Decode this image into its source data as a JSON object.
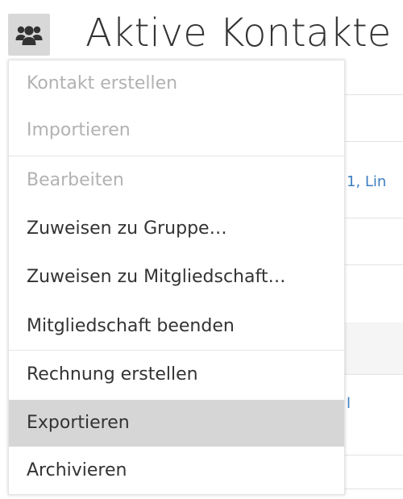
{
  "header": {
    "icon": "users-icon",
    "title": "Aktive Kontakte"
  },
  "background_table": {
    "row_link_1": "1, Lin",
    "row_link_2": "l"
  },
  "menu": {
    "items": [
      {
        "label": "Kontakt erstellen",
        "state": "disabled"
      },
      {
        "label": "Importieren",
        "state": "disabled"
      },
      {
        "label": "Bearbeiten",
        "state": "disabled"
      },
      {
        "label": "Zuweisen zu Gruppe…",
        "state": "enabled"
      },
      {
        "label": "Zuweisen zu Mitgliedschaft…",
        "state": "enabled"
      },
      {
        "label": "Mitgliedschaft beenden",
        "state": "enabled"
      },
      {
        "label": "Rechnung erstellen",
        "state": "enabled"
      },
      {
        "label": "Exportieren",
        "state": "highlighted"
      },
      {
        "label": "Archivieren",
        "state": "enabled"
      }
    ]
  },
  "colors": {
    "link": "#3d7fc1",
    "disabled_text": "#b2b2b2",
    "highlight": "#d6d6d6",
    "icon_button_bg": "#d8d8d8"
  }
}
